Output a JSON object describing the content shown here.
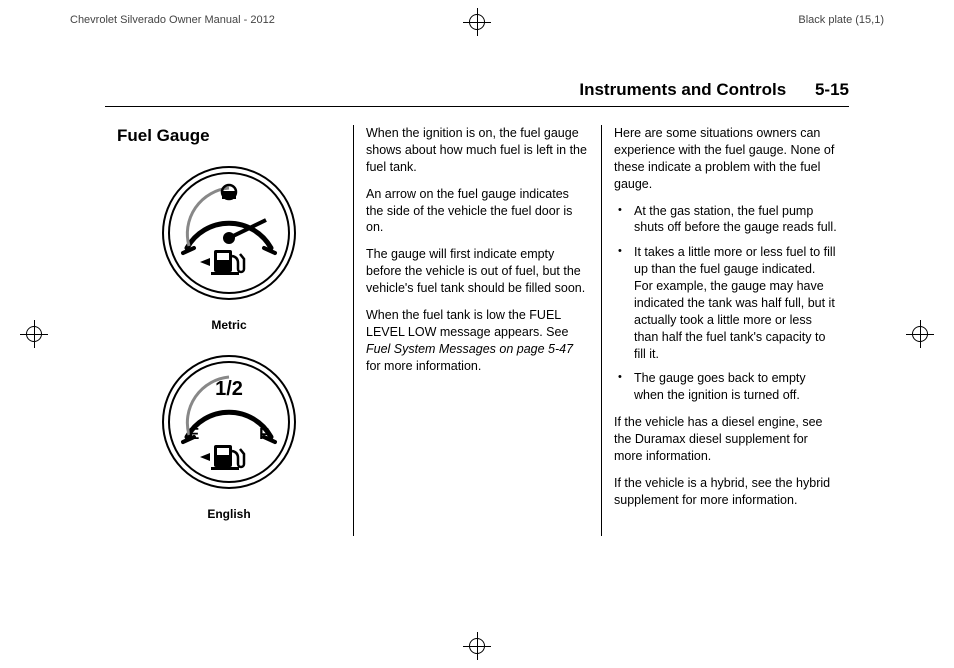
{
  "header": {
    "left": "Chevrolet Silverado Owner Manual - 2012",
    "right": "Black plate (15,1)"
  },
  "running_head": {
    "title": "Instruments and Controls",
    "page": "5-15"
  },
  "col1": {
    "heading": "Fuel Gauge",
    "caption_metric": "Metric",
    "caption_english": "English",
    "gauge_english": {
      "half": "1/2",
      "empty": "E",
      "full": "F"
    }
  },
  "col2": {
    "p1": "When the ignition is on, the fuel gauge shows about how much fuel is left in the fuel tank.",
    "p2": "An arrow on the fuel gauge indicates the side of the vehicle the fuel door is on.",
    "p3": "The gauge will first indicate empty before the vehicle is out of fuel, but the vehicle's fuel tank should be filled soon.",
    "p4a": "When the fuel tank is low the FUEL LEVEL LOW message appears. See ",
    "p4b_ital": "Fuel System Messages on page 5-47",
    "p4c": " for more information."
  },
  "col3": {
    "intro": "Here are some situations owners can experience with the fuel gauge. None of these indicate a problem with the fuel gauge.",
    "bullets": [
      "At the gas station, the fuel pump shuts off before the gauge reads full.",
      "It takes a little more or less fuel to fill up than the fuel gauge indicated. For example, the gauge may have indicated the tank was half full, but it actually took a little more or less than half the fuel tank's capacity to fill it.",
      "The gauge goes back to empty when the ignition is turned off."
    ],
    "p_diesel": "If the vehicle has a diesel engine, see the Duramax diesel supplement for more information.",
    "p_hybrid": "If the vehicle is a hybrid, see the hybrid supplement for more information."
  }
}
